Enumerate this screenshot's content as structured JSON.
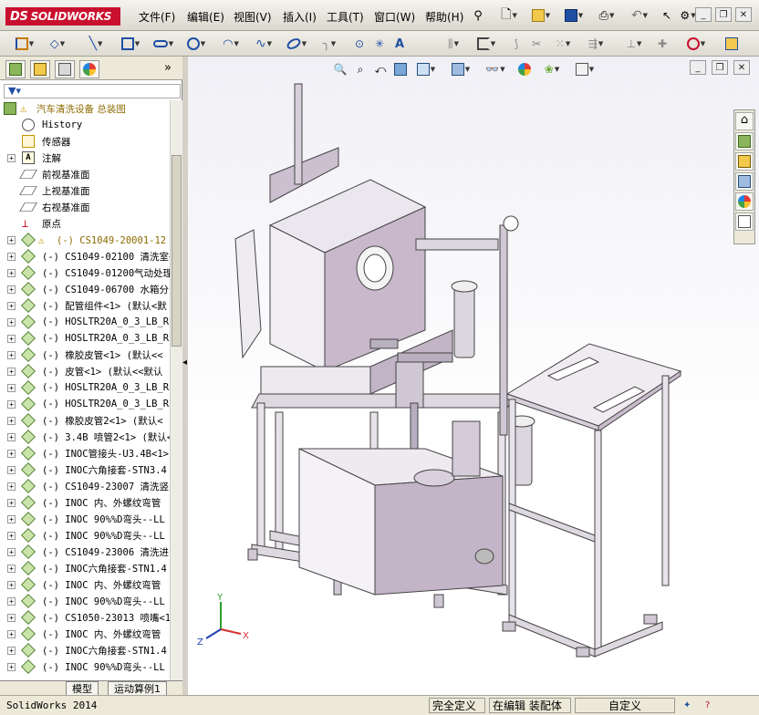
{
  "app": {
    "logo_text": "SOLIDWORKS",
    "logo_mark": "DS"
  },
  "menu": [
    {
      "id": "file",
      "label": "文件(F)"
    },
    {
      "id": "edit",
      "label": "编辑(E)"
    },
    {
      "id": "view",
      "label": "视图(V)"
    },
    {
      "id": "insert",
      "label": "插入(I)"
    },
    {
      "id": "tools",
      "label": "工具(T)"
    },
    {
      "id": "window",
      "label": "窗口(W)"
    },
    {
      "id": "help",
      "label": "帮助(H)"
    }
  ],
  "tree": {
    "root_label": "汽车清洗设备  总装图",
    "items": [
      {
        "label": "History"
      },
      {
        "label": "传感器"
      },
      {
        "label": "注解"
      },
      {
        "label": "前视基准面"
      },
      {
        "label": "上视基准面"
      },
      {
        "label": "右视基准面"
      },
      {
        "label": "原点"
      },
      {
        "label": "(-) CS1049-20001-12 连"
      },
      {
        "label": "(-) CS1049-02100 清洗室<"
      },
      {
        "label": "(-) CS1049-01200气动处理"
      },
      {
        "label": "(-) CS1049-06700 水箱分"
      },
      {
        "label": "(-) 配管组件<1> (默认<默"
      },
      {
        "label": "(-) HOSLTR20A_0_3_LB_RB"
      },
      {
        "label": "(-) HOSLTR20A_0_3_LB_RB"
      },
      {
        "label": "(-) 橡胶皮管<1> (默认<<"
      },
      {
        "label": "(-) 皮管<1> (默认<<默认"
      },
      {
        "label": "(-) HOSLTR20A_0_3_LB_RB"
      },
      {
        "label": "(-) HOSLTR20A_0_3_LB_RB"
      },
      {
        "label": "(-) 橡胶皮管2<1> (默认<"
      },
      {
        "label": "(-) 3.4B 喷管2<1> (默认<"
      },
      {
        "label": "(-) INOC管接头-U3.4B<1>"
      },
      {
        "label": "(-) INOC六角接套-STN3.4"
      },
      {
        "label": "(-) CS1049-23007 清洗竖"
      },
      {
        "label": "(-) INOC 内、外螺纹弯管"
      },
      {
        "label": "(-) INOC 90%%D弯头--LL"
      },
      {
        "label": "(-) INOC 90%%D弯头--LL"
      },
      {
        "label": "(-) CS1049-23006 清洗进"
      },
      {
        "label": "(-) INOC六角接套-STN1.4"
      },
      {
        "label": "(-) INOC 内、外螺纹弯管"
      },
      {
        "label": "(-) INOC 90%%D弯头--LL"
      },
      {
        "label": "(-) CS1050-23013 喷嘴<1"
      },
      {
        "label": "(-) INOC 内、外螺纹弯管"
      },
      {
        "label": "(-) INOC六角接套-STN1.4"
      },
      {
        "label": "(-) INOC 90%%D弯头--LL"
      }
    ]
  },
  "bottom_tabs": [
    {
      "label": "模型"
    },
    {
      "label": "运动算例1"
    }
  ],
  "triad": {
    "x": "X",
    "y": "Y",
    "z": "Z"
  },
  "status": {
    "app_name": "SolidWorks 2014",
    "definition": "完全定义",
    "editing": "在编辑 装配体",
    "custom": "自定义"
  }
}
